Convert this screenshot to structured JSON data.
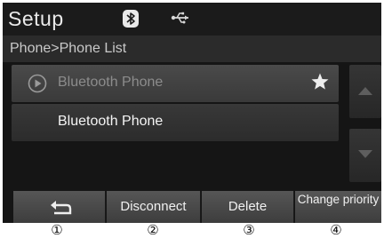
{
  "header": {
    "title": "Setup",
    "status_icons": [
      "bluetooth-icon",
      "usb-icon"
    ]
  },
  "breadcrumb": "Phone>Phone List",
  "phone_list": [
    {
      "label": "Bluetooth Phone",
      "state": "connected",
      "icon": "play-circle-icon",
      "badge": "star-icon"
    },
    {
      "label": "Bluetooth Phone",
      "state": "idle"
    }
  ],
  "scroll": {
    "up": "scroll-up-icon",
    "down": "scroll-down-icon"
  },
  "buttons": {
    "back_icon": "back-arrow-icon",
    "disconnect": "Disconnect",
    "delete": "Delete",
    "change_priority": "Change priority"
  },
  "callouts": [
    "①",
    "②",
    "③",
    "④"
  ],
  "colors": {
    "background": "#151515",
    "header": "#1b1b1b",
    "button": "#4a4a4a",
    "text": "#f0f0f0"
  }
}
